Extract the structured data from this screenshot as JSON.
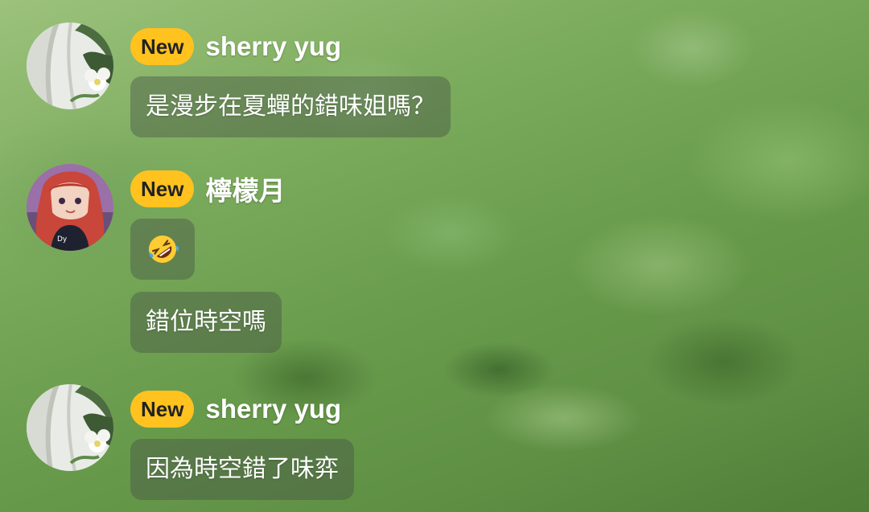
{
  "messages": [
    {
      "badge": "New",
      "username": "sherry yug",
      "avatar_icon": "flower-character-avatar",
      "lines": [
        "是漫步在夏蟬的錯味姐嗎？"
      ]
    },
    {
      "badge": "New",
      "username": "檸檬月",
      "avatar_icon": "anime-girl-avatar",
      "emoji": "rolling-on-floor-laughing-emoji",
      "lines": [
        "錯位時空嗎"
      ]
    },
    {
      "badge": "New",
      "username": "sherry yug",
      "avatar_icon": "flower-character-avatar",
      "lines": [
        "因為時空錯了味弈"
      ]
    }
  ],
  "colors": {
    "badge": "#ffc21f",
    "bubble": "rgba(70,80,70,0.42)",
    "text": "#ffffff",
    "background": "#6a9c4d"
  }
}
